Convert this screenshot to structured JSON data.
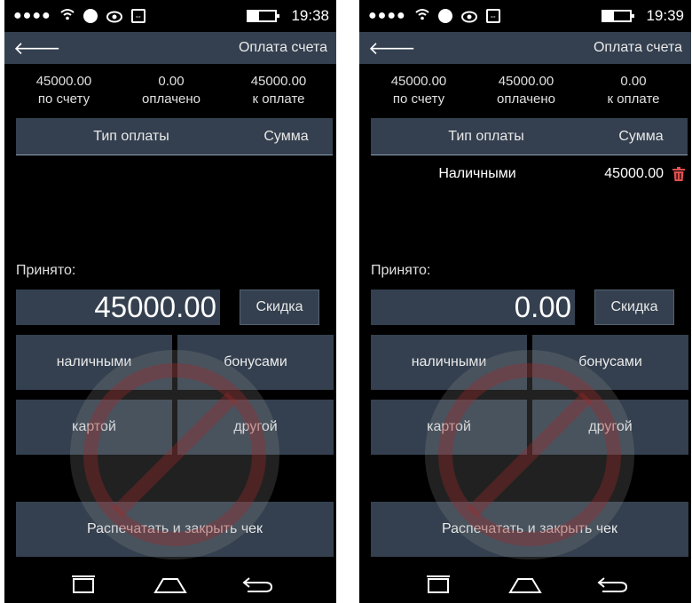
{
  "screens": [
    {
      "status_bar": {
        "time": "19:38"
      },
      "app_bar": {
        "title": "Оплата счета"
      },
      "summary": [
        {
          "value": "45000.00",
          "label": "по счету"
        },
        {
          "value": "0.00",
          "label": "оплачено"
        },
        {
          "value": "45000.00",
          "label": "к оплате"
        }
      ],
      "table": {
        "col_type": "Тип оплаты",
        "col_sum": "Сумма",
        "rows": []
      },
      "accepted_label": "Принято:",
      "amount": "45000.00",
      "discount_button": "Скидка",
      "payment_buttons": {
        "cash": "наличными",
        "bonus": "бонусами",
        "card": "картой",
        "other": "другой"
      },
      "print_button": "Распечатать и закрыть чек"
    },
    {
      "status_bar": {
        "time": "19:39"
      },
      "app_bar": {
        "title": "Оплата счета"
      },
      "summary": [
        {
          "value": "45000.00",
          "label": "по счету"
        },
        {
          "value": "45000.00",
          "label": "оплачено"
        },
        {
          "value": "0.00",
          "label": "к оплате"
        }
      ],
      "table": {
        "col_type": "Тип оплаты",
        "col_sum": "Сумма",
        "rows": [
          {
            "type": "Наличными",
            "sum": "45000.00"
          }
        ]
      },
      "accepted_label": "Принято:",
      "amount": "0.00",
      "discount_button": "Скидка",
      "payment_buttons": {
        "cash": "наличными",
        "bonus": "бонусами",
        "card": "картой",
        "other": "другой"
      },
      "print_button": "Распечатать и закрыть чек"
    }
  ],
  "colors": {
    "background": "#000000",
    "panel": "#34404f",
    "delete": "#e05050"
  },
  "icons": [
    "back-arrow-icon",
    "trash-icon",
    "recent-apps-icon",
    "home-icon",
    "back-nav-icon",
    "wifi-icon",
    "battery-icon"
  ]
}
